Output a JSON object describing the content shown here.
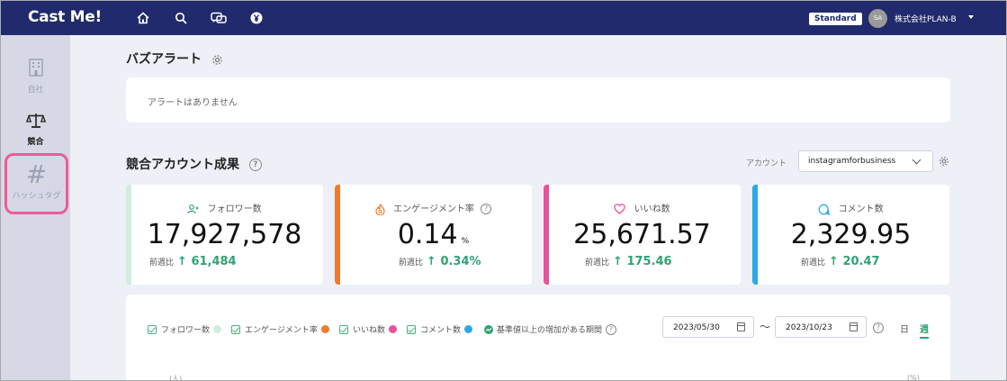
{
  "app": {
    "logo": "Cast Me!"
  },
  "header": {
    "plan": "Standard",
    "avatar_initials": "SA",
    "company": "株式会社PLAN-B",
    "nav_icons": [
      "home-icon",
      "search-icon",
      "chat-icon",
      "yen-icon"
    ]
  },
  "sidebar": {
    "items": [
      {
        "label": "自社",
        "icon": "building-icon",
        "active": false
      },
      {
        "label": "競合",
        "icon": "scale-icon",
        "active": true
      },
      {
        "label": "ハッシュタグ",
        "icon": "hashtag-icon",
        "active": false,
        "highlighted": true
      }
    ]
  },
  "buzz": {
    "title": "バズアラート",
    "empty": "アラートはありません"
  },
  "competitor": {
    "title": "競合アカウント成果",
    "account_label": "アカウント",
    "account_value": "instagramforbusiness"
  },
  "metrics": [
    {
      "label": "フォロワー数",
      "value": "17,927,578",
      "unit": "",
      "delta_label": "前週比",
      "delta": "61,484",
      "color": "#cfeedd"
    },
    {
      "label": "エンゲージメント率",
      "value": "0.14",
      "unit": "%",
      "delta_label": "前週比",
      "delta": "0.34%",
      "color": "#f07a2a"
    },
    {
      "label": "いいね数",
      "value": "25,671.57",
      "unit": "",
      "delta_label": "前週比",
      "delta": "175.46",
      "color": "#e9519a"
    },
    {
      "label": "コメント数",
      "value": "2,329.95",
      "unit": "",
      "delta_label": "前週比",
      "delta": "20.47",
      "color": "#2ba8e8"
    }
  ],
  "chart_controls": {
    "legend": [
      {
        "label": "フォロワー数",
        "color": "#cfeedd"
      },
      {
        "label": "エンゲージメント率",
        "color": "#f07a2a"
      },
      {
        "label": "いいね数",
        "color": "#e9519a"
      },
      {
        "label": "コメント数",
        "color": "#2ba8e8"
      }
    ],
    "threshold_label": "基準値以上の増加がある期間",
    "date_from": "2023/05/30",
    "date_to": "2023/10/23",
    "tilde": "〜",
    "period_day": "日",
    "period_week": "週",
    "axis_left": "(人)",
    "axis_right": "(%)"
  }
}
